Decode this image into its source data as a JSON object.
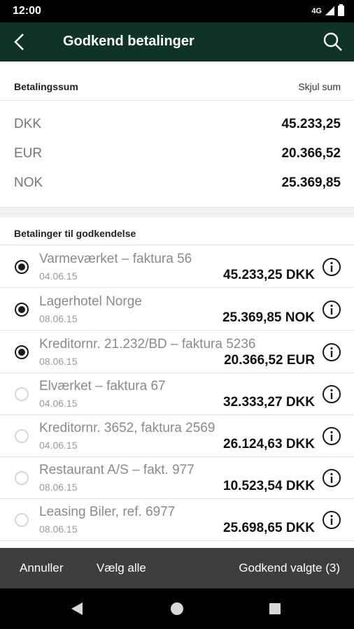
{
  "status_bar": {
    "time": "12:00",
    "network": "4G"
  },
  "app_bar": {
    "title": "Godkend betalinger",
    "back_icon": "chevron-left-icon",
    "search_icon": "search-icon"
  },
  "summary": {
    "heading": "Betalingssum",
    "hide_label": "Skjul sum",
    "rows": [
      {
        "currency": "DKK",
        "amount": "45.233,25"
      },
      {
        "currency": "EUR",
        "amount": "20.366,52"
      },
      {
        "currency": "NOK",
        "amount": "25.369,85"
      }
    ]
  },
  "payments": {
    "heading": "Betalinger til godkendelse",
    "items": [
      {
        "name": "Varmeværket – faktura 56",
        "date": "04.06.15",
        "amount": "45.233,25 DKK",
        "selected": true
      },
      {
        "name": "Lagerhotel Norge",
        "date": "08.06.15",
        "amount": "25.369,85 NOK",
        "selected": true
      },
      {
        "name": "Kreditornr. 21.232/BD – faktura 5236",
        "date": "08.06.15",
        "amount": "20.366,52 EUR",
        "selected": true
      },
      {
        "name": "Elværket – faktura 67",
        "date": "04.06.15",
        "amount": "32.333,27 DKK",
        "selected": false
      },
      {
        "name": "Kreditornr. 3652, faktura 2569",
        "date": "04.06.15",
        "amount": "26.124,63 DKK",
        "selected": false
      },
      {
        "name": "Restaurant A/S – fakt. 977",
        "date": "08.06.15",
        "amount": "10.523,54 DKK",
        "selected": false
      },
      {
        "name": "Leasing Biler, ref. 6977",
        "date": "08.06.15",
        "amount": "25.698,65 DKK",
        "selected": false
      }
    ]
  },
  "actions": {
    "cancel": "Annuller",
    "select_all": "Vælg alle",
    "approve": "Godkend valgte (3)"
  },
  "colors": {
    "app_bar": "#0f3326",
    "bottom_bar": "#3e3e3e"
  }
}
